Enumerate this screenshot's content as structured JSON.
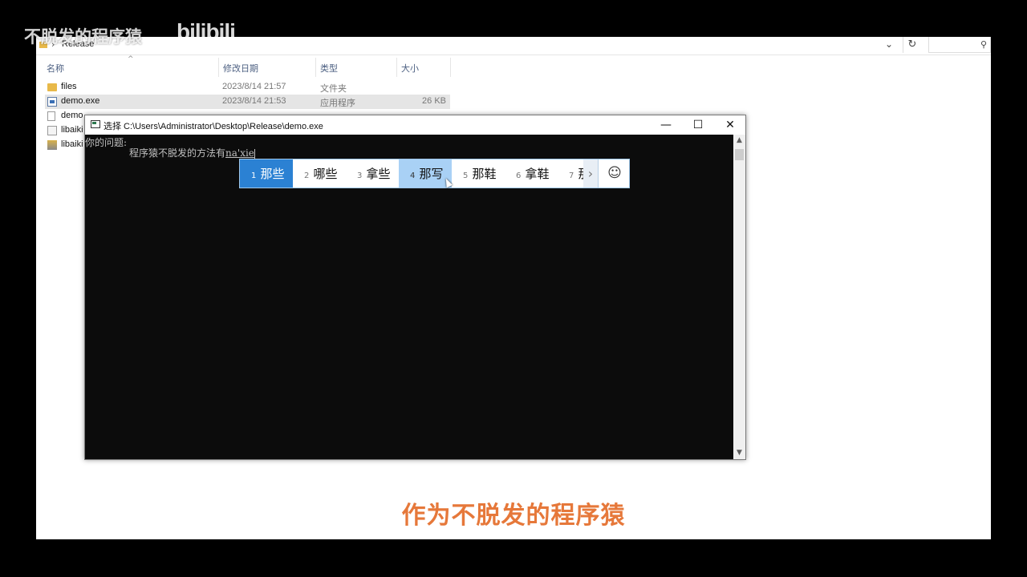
{
  "explorer": {
    "path_label": "Release",
    "columns": {
      "name": "名称",
      "date": "修改日期",
      "type": "类型",
      "size": "大小"
    },
    "files": [
      {
        "name": "files",
        "date": "2023/8/14 21:57",
        "type": "文件夹",
        "size": "",
        "icon": "folder-icon",
        "selected": false
      },
      {
        "name": "demo.exe",
        "date": "2023/8/14 21:53",
        "type": "应用程序",
        "size": "26 KB",
        "icon": "exe-icon",
        "selected": true
      },
      {
        "name": "demo",
        "date": "",
        "type": "",
        "size": "",
        "icon": "file-icon",
        "selected": false
      },
      {
        "name": "libaiki",
        "date": "",
        "type": "",
        "size": "",
        "icon": "dll-icon",
        "selected": false
      },
      {
        "name": "libaiki",
        "date": "",
        "type": "",
        "size": "",
        "icon": "package-icon",
        "selected": false
      }
    ]
  },
  "console": {
    "title": "选择 C:\\Users\\Administrator\\Desktop\\Release\\demo.exe",
    "prompt": "你的问题:",
    "input_text": "程序猿不脱发的方法有",
    "composition": "na'xie"
  },
  "ime": {
    "candidates": [
      {
        "num": "1",
        "text": "那些"
      },
      {
        "num": "2",
        "text": "哪些"
      },
      {
        "num": "3",
        "text": "拿些"
      },
      {
        "num": "4",
        "text": "那写"
      },
      {
        "num": "5",
        "text": "那鞋"
      },
      {
        "num": "6",
        "text": "拿鞋"
      },
      {
        "num": "7",
        "text": "那"
      }
    ]
  },
  "subtitle": "作为不脱发的程序猿",
  "watermark": {
    "text": "不脱发的程序猿",
    "logo": "bilibili"
  },
  "colors": {
    "subtitle": "#e6783a",
    "ime_selected": "#2b81d3",
    "ime_hover": "#a9d1f5",
    "console_bg": "#0c0c0c"
  }
}
